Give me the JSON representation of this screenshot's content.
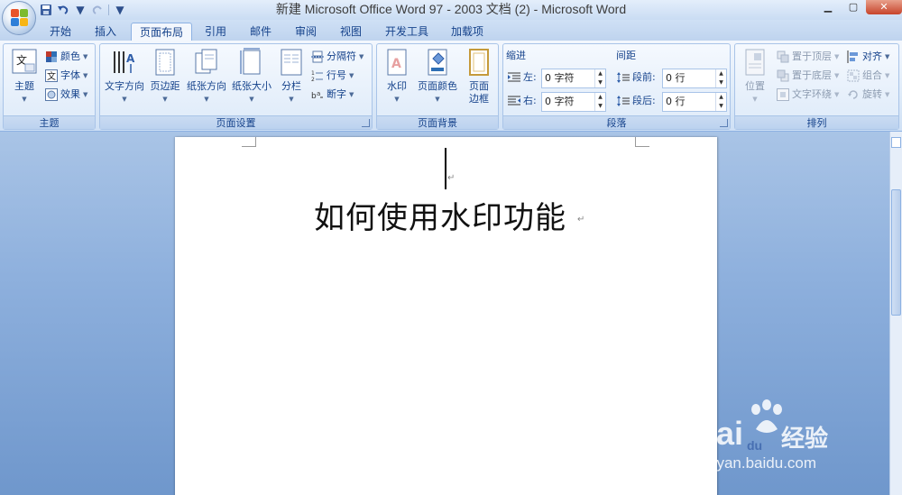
{
  "window": {
    "title": "新建 Microsoft Office Word 97 - 2003 文档 (2) - Microsoft Word",
    "minimize_icon": "minimize-icon",
    "maximize_icon": "maximize-icon",
    "close_icon": "close-icon"
  },
  "quick_access": {
    "save_icon": "save-icon",
    "undo_icon": "undo-icon",
    "redo_icon": "redo-icon",
    "customize_icon": "chevron-down-icon"
  },
  "tabs": [
    {
      "label": "开始",
      "active": false
    },
    {
      "label": "插入",
      "active": false
    },
    {
      "label": "页面布局",
      "active": true
    },
    {
      "label": "引用",
      "active": false
    },
    {
      "label": "邮件",
      "active": false
    },
    {
      "label": "审阅",
      "active": false
    },
    {
      "label": "视图",
      "active": false
    },
    {
      "label": "开发工具",
      "active": false
    },
    {
      "label": "加载项",
      "active": false
    }
  ],
  "ribbon": {
    "theme": {
      "group_label": "主题",
      "themes_button": "主题",
      "colors": "颜色",
      "fonts": "字体",
      "effects": "效果"
    },
    "page_setup": {
      "group_label": "页面设置",
      "text_direction": "文字方向",
      "margins": "页边距",
      "orientation": "纸张方向",
      "size": "纸张大小",
      "columns": "分栏",
      "breaks": "分隔符",
      "line_numbers": "行号",
      "hyphenation": "断字"
    },
    "page_background": {
      "group_label": "页面背景",
      "watermark": "水印",
      "page_color": "页面颜色",
      "page_borders_line1": "页面",
      "page_borders_line2": "边框"
    },
    "paragraph": {
      "group_label": "段落",
      "indent_header": "缩进",
      "spacing_header": "间距",
      "indent_left_label": "左:",
      "indent_left_value": "0 字符",
      "indent_right_label": "右:",
      "indent_right_value": "0 字符",
      "spacing_before_label": "段前:",
      "spacing_before_value": "0 行",
      "spacing_after_label": "段后:",
      "spacing_after_value": "0 行"
    },
    "arrange": {
      "group_label": "排列",
      "position": "位置",
      "bring_to_front": "置于顶层",
      "send_to_back": "置于底层",
      "text_wrapping": "文字环绕",
      "align": "对齐",
      "group": "组合",
      "rotate": "旋转"
    }
  },
  "document": {
    "heading_text": "如何使用水印功能",
    "paragraph_mark": "↵"
  },
  "watermark": {
    "brand_latin": "Bai",
    "brand_du": "du",
    "brand_cn": "经验",
    "url": "jingyan.baidu.com"
  },
  "colors": {
    "ribbon_text": "#15428b",
    "workspace_bg": "#8eb0dd",
    "active_tab_border": "#8db2e3"
  }
}
